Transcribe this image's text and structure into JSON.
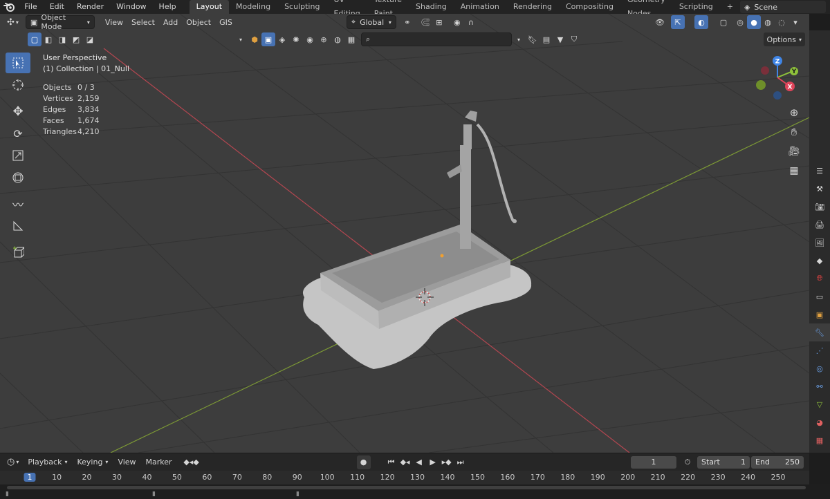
{
  "menu": [
    "File",
    "Edit",
    "Render",
    "Window",
    "Help"
  ],
  "workspaces": {
    "active": "Layout",
    "tabs": [
      "Layout",
      "Modeling",
      "Sculpting",
      "UV Editing",
      "Texture Paint",
      "Shading",
      "Animation",
      "Rendering",
      "Compositing",
      "Geometry Nodes",
      "Scripting"
    ]
  },
  "scene": {
    "name": "Scene"
  },
  "header": {
    "mode": "Object Mode",
    "menus": [
      "View",
      "Select",
      "Add",
      "Object",
      "GIS"
    ],
    "orientation": "Global",
    "options": "Options"
  },
  "overlay": {
    "perspective": "User Perspective",
    "collection": "(1) Collection | 01_Null",
    "stats": [
      {
        "label": "Objects",
        "value": "0 / 3"
      },
      {
        "label": "Vertices",
        "value": "2,159"
      },
      {
        "label": "Edges",
        "value": "3,834"
      },
      {
        "label": "Faces",
        "value": "1,674"
      },
      {
        "label": "Triangles",
        "value": "4,210"
      }
    ]
  },
  "gizmo": {
    "x": "X",
    "y": "Y",
    "z": "Z"
  },
  "timeline": {
    "playback": "Playback",
    "keying": "Keying",
    "view": "View",
    "marker": "Marker",
    "current_frame": "1",
    "start_label": "Start",
    "start": "1",
    "end_label": "End",
    "end": "250",
    "ruler": [
      "1",
      "10",
      "20",
      "30",
      "40",
      "50",
      "60",
      "70",
      "80",
      "90",
      "100",
      "110",
      "120",
      "130",
      "140",
      "150",
      "160",
      "170",
      "180",
      "190",
      "200",
      "210",
      "220",
      "230",
      "240",
      "250"
    ]
  },
  "colors": {
    "accent": "#4772b3",
    "axis_x": "#e0445a",
    "axis_y": "#8fc23b",
    "axis_z": "#3f85e6"
  }
}
